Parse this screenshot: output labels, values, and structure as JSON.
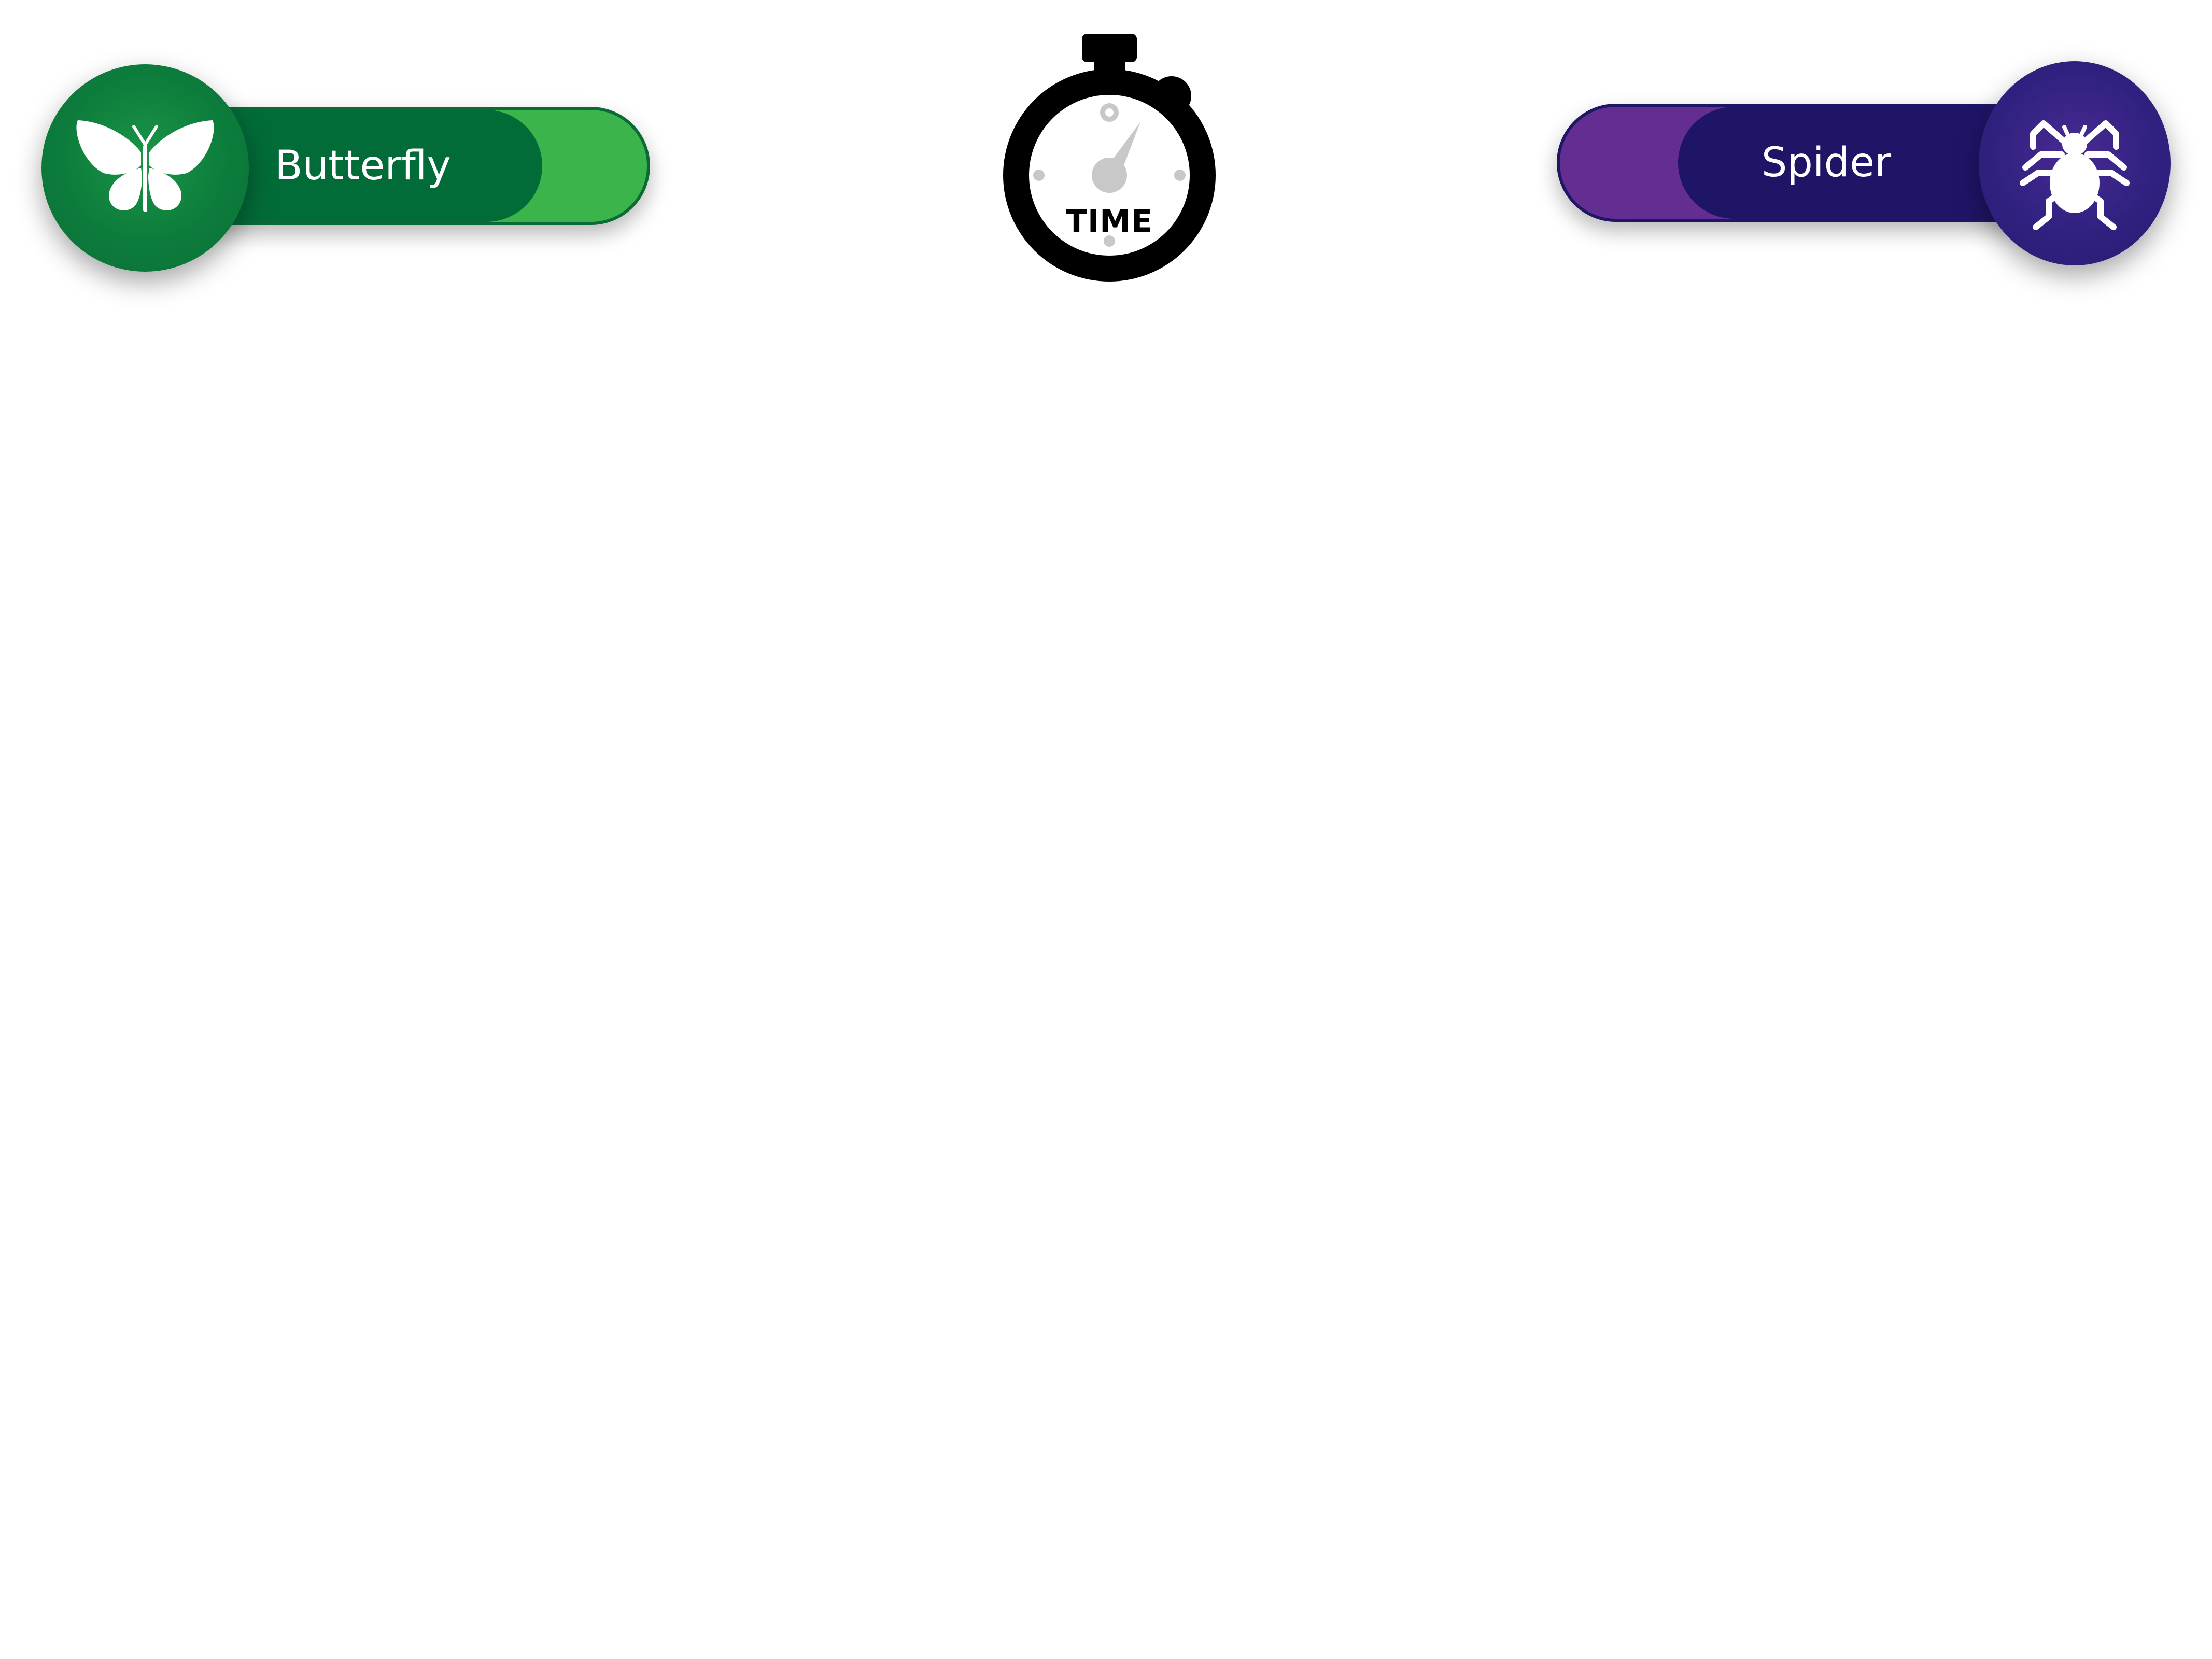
{
  "players": {
    "left": {
      "name": "Butterfly",
      "icon": "butterfly-icon",
      "accent_color": "#3bb54b",
      "fill_color": "#026c38",
      "badge_color": "#0c7c3c"
    },
    "right": {
      "name": "Spider",
      "icon": "spider-icon",
      "accent_color": "#642d91",
      "fill_color": "#1e1567",
      "badge_color": "#302180"
    }
  },
  "timer": {
    "label": "TIME",
    "icon": "stopwatch-icon"
  }
}
